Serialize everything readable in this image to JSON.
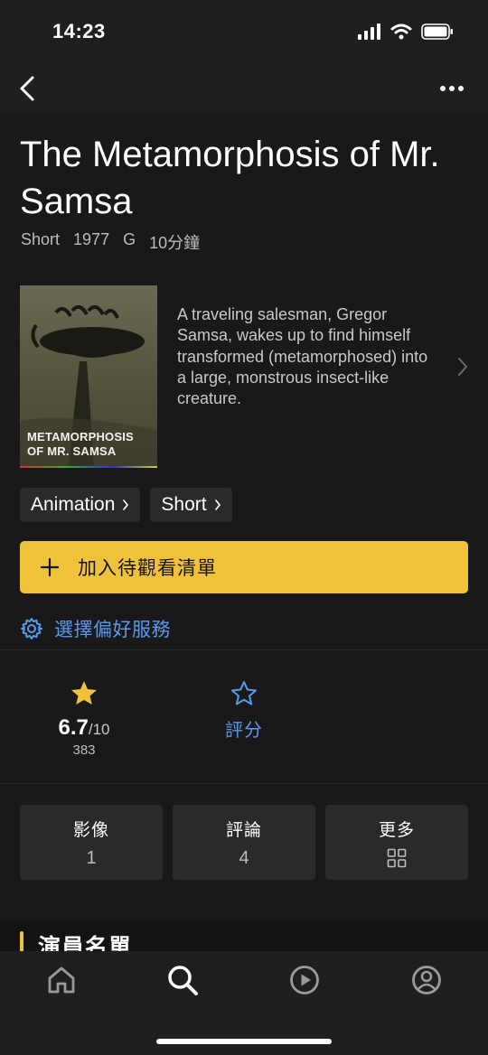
{
  "status_bar": {
    "time": "14:23"
  },
  "nav": {
    "back_icon": "chevron-left-icon",
    "more_icon": "more-horizontal-icon"
  },
  "title": {
    "line1": "The Metamorphosis of Mr.",
    "line2": "Samsa"
  },
  "meta": {
    "type": "Short",
    "year": "1977",
    "rating": "G",
    "duration": "10分鐘"
  },
  "poster": {
    "text_line1": "METAMORPHOSIS",
    "text_line2": "OF MR. SAMSA"
  },
  "plot": "A traveling salesman, Gregor Samsa, wakes up to find himself transformed (metamorphosed) into a large, monstrous insect-like creature.",
  "genres": [
    {
      "label": "Animation"
    },
    {
      "label": "Short"
    }
  ],
  "watchlist": {
    "label": "加入待觀看清單",
    "icon": "plus-icon"
  },
  "preferences": {
    "label": "選擇偏好服務",
    "icon": "gear-icon"
  },
  "rating": {
    "value": "6.7",
    "max": "/10",
    "count": "383",
    "icon": "star-filled-icon"
  },
  "rate": {
    "label": "評分",
    "icon": "star-outline-icon"
  },
  "tiles": [
    {
      "label": "影像",
      "count": "1"
    },
    {
      "label": "評論",
      "count": "4"
    },
    {
      "label": "更多",
      "icon": "grid-icon"
    }
  ],
  "cast": {
    "title": "演員名單"
  },
  "tabs": [
    {
      "name": "home",
      "icon": "home-icon"
    },
    {
      "name": "search",
      "icon": "search-icon"
    },
    {
      "name": "video",
      "icon": "play-circle-icon"
    },
    {
      "name": "profile",
      "icon": "profile-icon"
    }
  ],
  "colors": {
    "accent_yellow": "#f0c23b",
    "link_blue": "#5a99ee",
    "background": "#191919",
    "surface": "#2a2a2a"
  }
}
